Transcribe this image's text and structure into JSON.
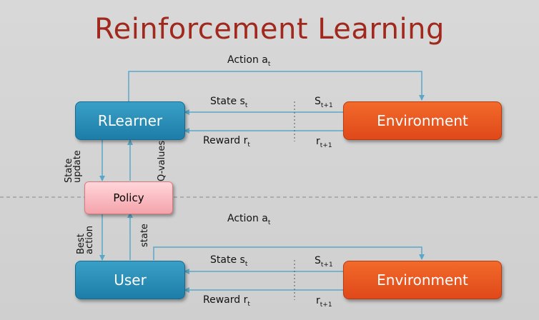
{
  "title": "Reinforcement Learning",
  "colors": {
    "title": "#a0281c",
    "blue_box": "#2a8fb8",
    "orange_box": "#e8561f",
    "policy_box": "#f7b8bf",
    "arrow": "#5aa8c8"
  },
  "top": {
    "learner": "RLearner",
    "environment": "Environment",
    "action": {
      "text": "Action a",
      "sub": "t"
    },
    "state": {
      "text": "State s",
      "sub": "t"
    },
    "reward": {
      "text": "Reward r",
      "sub": "t"
    },
    "next_state": {
      "text": "S",
      "sub": "t+1"
    },
    "next_reward": {
      "text": "r",
      "sub": "t+1"
    }
  },
  "policy": "Policy",
  "side_labels": {
    "state_update_1": "State",
    "state_update_2": "update",
    "q_values": "Q-values",
    "best_action_1": "Best",
    "best_action_2": "action",
    "state": "state"
  },
  "bottom": {
    "user": "User",
    "environment": "Environment",
    "action": {
      "text": "Action a",
      "sub": "t"
    },
    "state": {
      "text": "State s",
      "sub": "t"
    },
    "reward": {
      "text": "Reward r",
      "sub": "t"
    },
    "next_state": {
      "text": "S",
      "sub": "t+1"
    },
    "next_reward": {
      "text": "r",
      "sub": "t+1"
    }
  }
}
